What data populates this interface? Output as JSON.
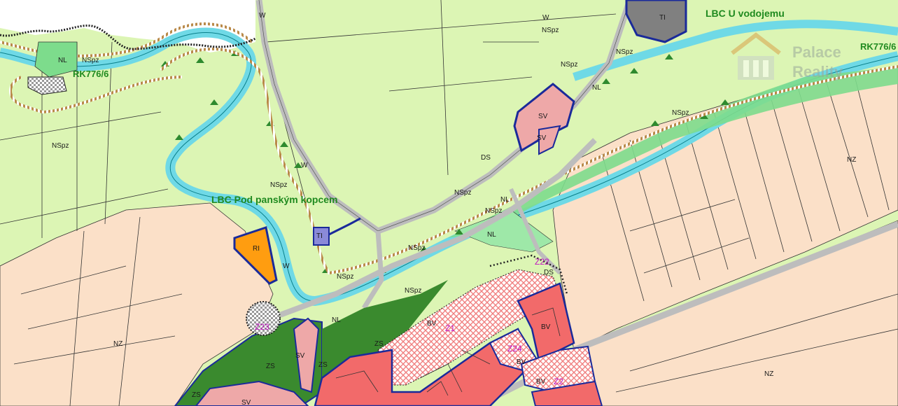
{
  "labels": {
    "lbc_u_vodojemu": "LBC U vodojemu",
    "lbc_pod_panskym": "LBC Pod panským kopcem",
    "rk_left": "RK776/6",
    "rk_right": "RK776/6",
    "nl": "NL",
    "nspz": "NSpz",
    "nz": "NZ",
    "ti": "TI",
    "ri": "RI",
    "w": "W",
    "ds": "DS",
    "sv": "SV",
    "zs": "ZS",
    "bv": "BV",
    "z1": "Z1",
    "z2": "Z2",
    "z22": "Z22",
    "z23": "Z23",
    "z24": "Z24"
  },
  "watermark": {
    "line1": "Palace",
    "line2": "Reality"
  },
  "colors": {
    "meadow": "#dcf5b4",
    "field": "#fbe0c8",
    "water": "#6fd9e6",
    "forest": "#3a8a2e",
    "lbc_green": "#7ddc8c",
    "residential": "#f26a6a",
    "mixed": "#eea8a8",
    "road": "#bdbdbd",
    "tech": "#808080",
    "recreation": "#ff9d10",
    "boundary": "#1a2a9a"
  }
}
